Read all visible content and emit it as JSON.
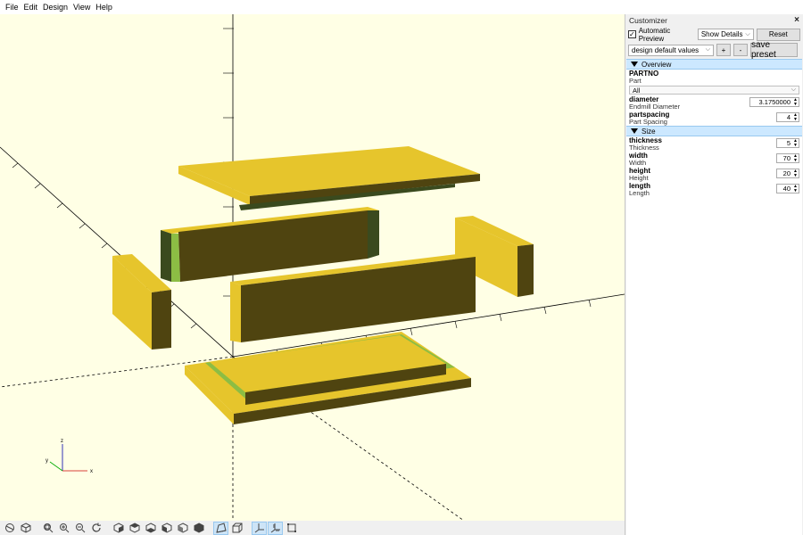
{
  "menu": [
    "File",
    "Edit",
    "Design",
    "View",
    "Help"
  ],
  "customizer": {
    "title": "Customizer",
    "close": "×",
    "automatic_preview": "Automatic Preview",
    "automatic_preview_checked": true,
    "checkmark": "✓",
    "details": "Show Details",
    "reset": "Reset",
    "preset": "design default values",
    "add_preset": "+",
    "remove_preset": "-",
    "save_preset": "save preset",
    "sections": {
      "overview": {
        "title": "Overview",
        "partno_name": "PARTNO",
        "partno_desc": "Part",
        "partno_value": "All",
        "diameter_name": "diameter",
        "diameter_desc": "Endmill Diameter",
        "diameter_value": "3.1750000",
        "partspacing_name": "partspacing",
        "partspacing_desc": "Part Spacing",
        "partspacing_value": "4"
      },
      "size": {
        "title": "Size",
        "thickness_name": "thickness",
        "thickness_desc": "Thickness",
        "thickness_value": "5",
        "width_name": "width",
        "width_desc": "Width",
        "width_value": "70",
        "height_name": "height",
        "height_desc": "Height",
        "height_value": "20",
        "length_name": "length",
        "length_desc": "Length",
        "length_value": "40"
      }
    }
  },
  "axes": {
    "x": "x",
    "y": "y",
    "z": "z"
  },
  "colors": {
    "background": "#ffffe5",
    "face_top": "#e6c52c",
    "face_side": "#4f4410",
    "face_green": "#8cbd44",
    "face_darkgreen": "#3a4a1e",
    "axis_line": "#000000",
    "selection": "#cce8ff"
  },
  "toolbar_icons": [
    "preview-icon",
    "render-icon",
    "view-all-icon",
    "zoom-in-icon",
    "zoom-out-icon",
    "reset-view-icon",
    "view-right-icon",
    "view-top-icon",
    "view-bottom-icon",
    "view-left-icon",
    "view-front-icon",
    "view-back-icon",
    "perspective-icon",
    "orthogonal-icon",
    "show-axes-icon",
    "show-scale-markers-icon",
    "show-edges-icon"
  ]
}
